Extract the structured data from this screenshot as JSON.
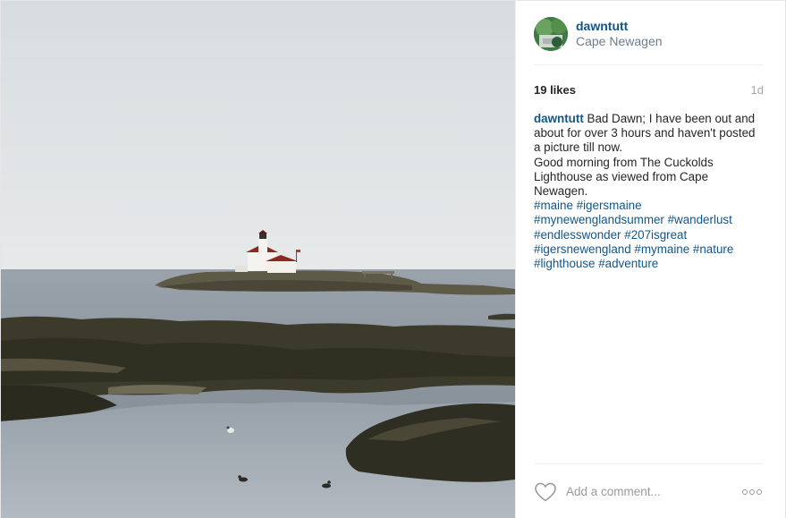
{
  "post": {
    "photo": {
      "alt": "",
      "colors": {
        "sky": "#dfe3e4",
        "sea": "#8f99a3",
        "rocks": "#3a3a2a",
        "lighthouse": "#f5f5f2",
        "roof": "#8b2a24"
      }
    },
    "header": {
      "username": "dawntutt",
      "location": "Cape Newagen"
    },
    "stats": {
      "likes": "19 likes",
      "age": "1d"
    },
    "caption": {
      "username": "dawntutt",
      "lines": [
        "Bad Dawn; I have been out and",
        "about for over 3 hours and haven't posted",
        "a picture till now.",
        "Good morning from The Cuckolds",
        "Lighthouse as viewed from Cape Newagen."
      ],
      "hashtag_lines": [
        "#maine #igersmaine",
        "#mynewenglandsummer #wanderlust",
        "#endlesswonder #207isgreat",
        "#igersnewengland #mymaine #nature",
        "#lighthouse #adventure"
      ]
    },
    "footer": {
      "comment_placeholder": "Add a comment...",
      "like_icon": "heart-icon",
      "more_icon": "more-options-icon"
    },
    "colors": {
      "link": "#125688",
      "muted": "#a5a7aa",
      "text": "#262626",
      "border": "#efefef"
    }
  }
}
